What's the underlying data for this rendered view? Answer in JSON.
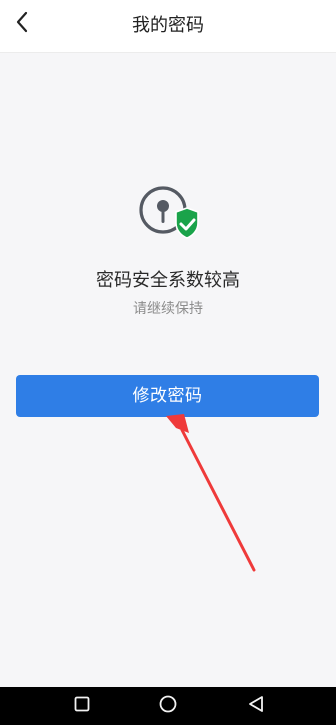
{
  "header": {
    "title": "我的密码",
    "back_icon": "chevron-left-icon"
  },
  "status": {
    "icon": "lock-shield-check-icon",
    "title": "密码安全系数较高",
    "subtitle": "请继续保持"
  },
  "actions": {
    "change_password_label": "修改密码"
  },
  "navigation": {
    "items": [
      {
        "icon": "square-recent-icon"
      },
      {
        "icon": "circle-home-icon"
      },
      {
        "icon": "triangle-back-icon"
      }
    ]
  },
  "colors": {
    "accent": "#2f7ee6",
    "shield": "#1aa34a",
    "annotation_arrow": "#ef3a3a"
  }
}
